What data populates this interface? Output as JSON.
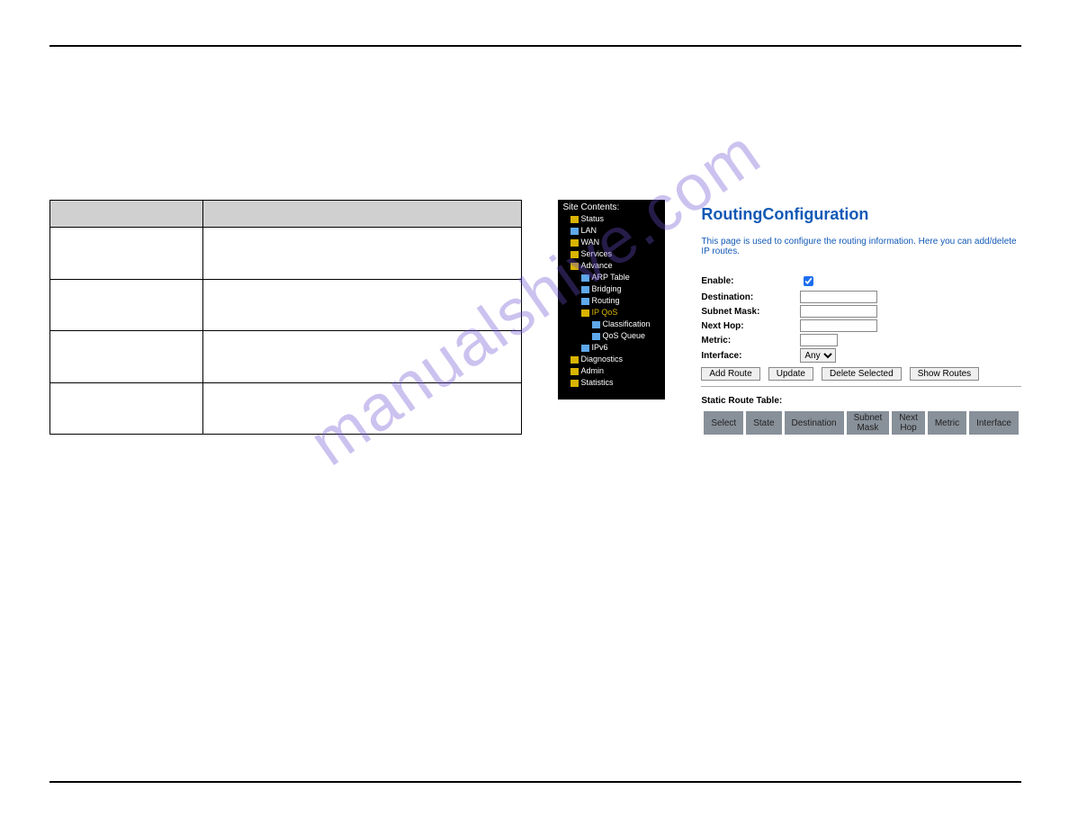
{
  "watermark": "manualshive.com",
  "docTable": {
    "headers": [
      "",
      ""
    ],
    "rows": [
      [
        "",
        ""
      ],
      [
        "",
        ""
      ],
      [
        "",
        ""
      ],
      [
        "",
        ""
      ]
    ]
  },
  "sidebar": {
    "title": "Site Contents:",
    "items": [
      {
        "label": "Status",
        "level": 1,
        "color": "yellow"
      },
      {
        "label": "LAN",
        "level": 1,
        "color": "blue"
      },
      {
        "label": "WAN",
        "level": 1,
        "color": "yellow"
      },
      {
        "label": "Services",
        "level": 1,
        "color": "yellow"
      },
      {
        "label": "Advance",
        "level": 1,
        "color": "yellow"
      },
      {
        "label": "ARP Table",
        "level": 2,
        "color": "blue"
      },
      {
        "label": "Bridging",
        "level": 2,
        "color": "blue"
      },
      {
        "label": "Routing",
        "level": 2,
        "color": "blue"
      },
      {
        "label": "IP QoS",
        "level": 2,
        "color": "yellow",
        "selected": true
      },
      {
        "label": "Classification",
        "level": 3,
        "color": "blue"
      },
      {
        "label": "QoS Queue",
        "level": 3,
        "color": "blue"
      },
      {
        "label": "IPv6",
        "level": 2,
        "color": "blue"
      },
      {
        "label": "Diagnostics",
        "level": 1,
        "color": "yellow"
      },
      {
        "label": "Admin",
        "level": 1,
        "color": "yellow"
      },
      {
        "label": "Statistics",
        "level": 1,
        "color": "yellow"
      }
    ]
  },
  "form": {
    "title": "RoutingConfiguration",
    "description": "This page is used to configure the routing information. Here you can add/delete IP routes.",
    "fields": {
      "enable_label": "Enable:",
      "enable_checked": true,
      "destination_label": "Destination:",
      "destination_value": "",
      "subnet_label": "Subnet Mask:",
      "subnet_value": "",
      "nexthop_label": "Next Hop:",
      "nexthop_value": "",
      "metric_label": "Metric:",
      "metric_value": "",
      "interface_label": "Interface:",
      "interface_value": "Any"
    },
    "buttons": {
      "add": "Add Route",
      "update": "Update",
      "delete": "Delete Selected",
      "show": "Show Routes"
    },
    "tableTitle": "Static Route Table:",
    "tableHeaders": [
      "Select",
      "State",
      "Destination",
      "Subnet Mask",
      "Next Hop",
      "Metric",
      "Interface"
    ]
  }
}
